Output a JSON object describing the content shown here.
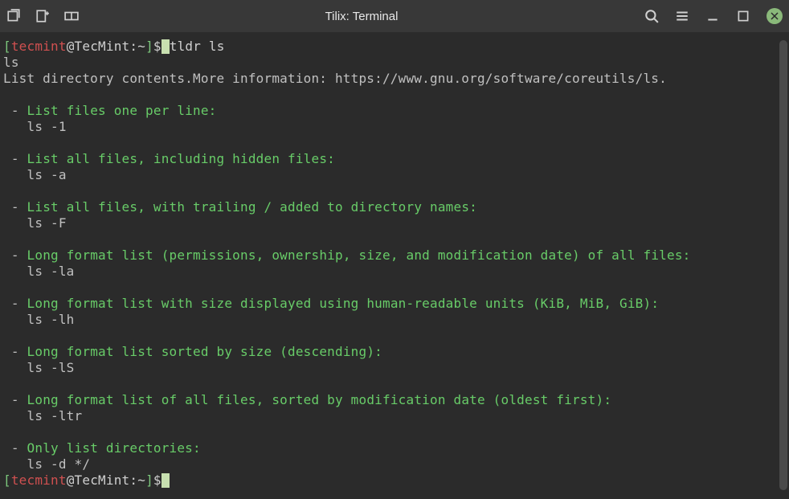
{
  "titlebar": {
    "title": "Tilix: Terminal"
  },
  "prompt": {
    "open": "[",
    "user": "tecmint",
    "at": "@",
    "host": "TecMint",
    "colon": ":",
    "path": "~",
    "close": "]",
    "dollar": "$"
  },
  "command": "tldr ls",
  "output": {
    "name": "ls",
    "summary": "List directory contents.More information: https://www.gnu.org/software/coreutils/ls.",
    "items": [
      {
        "desc": "List files one per line:",
        "cmd": "ls -1"
      },
      {
        "desc": "List all files, including hidden files:",
        "cmd": "ls -a"
      },
      {
        "desc": "List all files, with trailing / added to directory names:",
        "cmd": "ls -F"
      },
      {
        "desc": "Long format list (permissions, ownership, size, and modification date) of all files:",
        "cmd": "ls -la"
      },
      {
        "desc": "Long format list with size displayed using human-readable units (KiB, MiB, GiB):",
        "cmd": "ls -lh"
      },
      {
        "desc": "Long format list sorted by size (descending):",
        "cmd": "ls -lS"
      },
      {
        "desc": "Long format list of all files, sorted by modification date (oldest first):",
        "cmd": "ls -ltr"
      },
      {
        "desc": "Only list directories:",
        "cmd": "ls -d */"
      }
    ]
  }
}
